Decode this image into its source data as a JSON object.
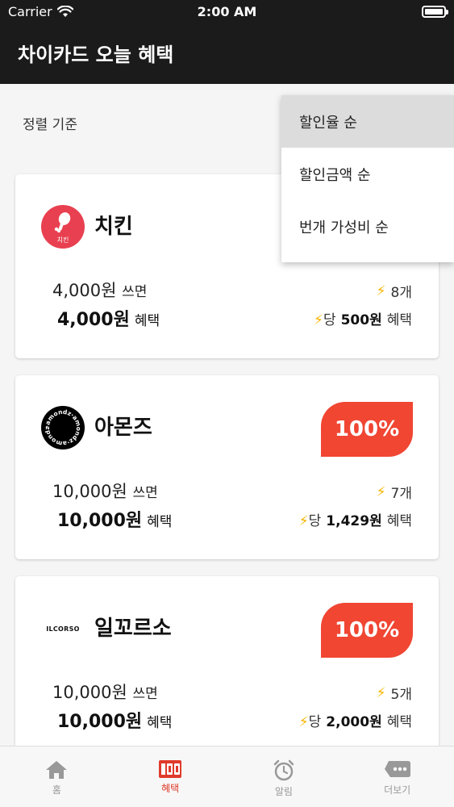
{
  "status": {
    "carrier": "Carrier",
    "time": "2:00 AM"
  },
  "header": {
    "title": "차이카드 오늘 혜택"
  },
  "sort": {
    "label": "정렬 기준",
    "options": [
      "할인율 순",
      "할인금액 순",
      "번개 가성비 순"
    ],
    "selected": "할인율 순"
  },
  "cards": [
    {
      "name": "치킨",
      "logo_text": "치킨",
      "logo_color": "#e84050",
      "badge": "",
      "spend": "4,000원",
      "spend_suffix": "쓰면",
      "benefit": "4,000원",
      "benefit_suffix": "혜택",
      "count": "8개",
      "per_prefix": "당",
      "per_value": "500원",
      "per_suffix": "혜택"
    },
    {
      "name": "아몬즈",
      "logo_text": "amondz",
      "logo_color": "#000000",
      "badge": "100%",
      "spend": "10,000원",
      "spend_suffix": "쓰면",
      "benefit": "10,000원",
      "benefit_suffix": "혜택",
      "count": "7개",
      "per_prefix": "당",
      "per_value": "1,429원",
      "per_suffix": "혜택"
    },
    {
      "name": "일꼬르소",
      "logo_text": "ILCORSO",
      "logo_color": "#ffffff",
      "badge": "100%",
      "spend": "10,000원",
      "spend_suffix": "쓰면",
      "benefit": "10,000원",
      "benefit_suffix": "혜택",
      "count": "5개",
      "per_prefix": "당",
      "per_value": "2,000원",
      "per_suffix": "혜택"
    }
  ],
  "tabs": [
    {
      "label": "홈",
      "icon": "home-icon",
      "active": false
    },
    {
      "label": "혜택",
      "icon": "benefit-100-icon",
      "active": true
    },
    {
      "label": "알림",
      "icon": "alarm-clock-icon",
      "active": false
    },
    {
      "label": "더보기",
      "icon": "more-bubble-icon",
      "active": false
    }
  ],
  "colors": {
    "accent": "#f04632",
    "header_bg": "#1b1b1b",
    "bolt": "#f7b500"
  }
}
